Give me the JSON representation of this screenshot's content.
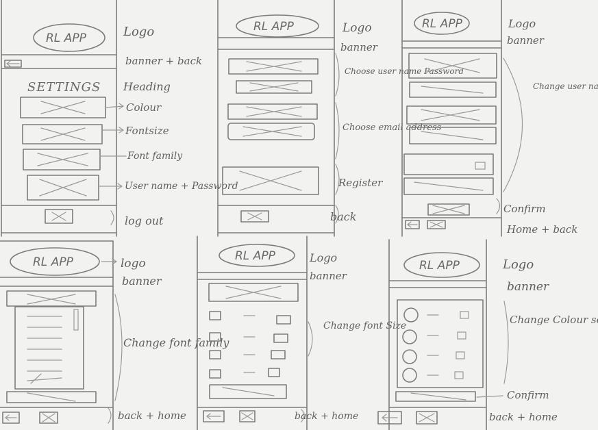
{
  "logo_text": "RL APP",
  "panels": [
    {
      "heading": "SETTINGS",
      "annotations": [
        "Logo",
        "banner + back",
        "Heading",
        "Colour",
        "Fontsize",
        "Font family",
        "User name + Password",
        "log out"
      ]
    },
    {
      "annotations": [
        "Logo",
        "banner",
        "Choose user name Password",
        "Choose email address",
        "Register",
        "back"
      ]
    },
    {
      "annotations": [
        "Logo",
        "banner",
        "Change user name + Password",
        "Confirm",
        "Home + back"
      ]
    },
    {
      "annotations": [
        "logo",
        "banner",
        "Change font family",
        "back + home"
      ]
    },
    {
      "annotations": [
        "Logo",
        "banner",
        "Change font Size",
        "back + home"
      ]
    },
    {
      "annotations": [
        "Logo",
        "banner",
        "Change Colour settings",
        "Confirm",
        "back + home"
      ]
    }
  ]
}
